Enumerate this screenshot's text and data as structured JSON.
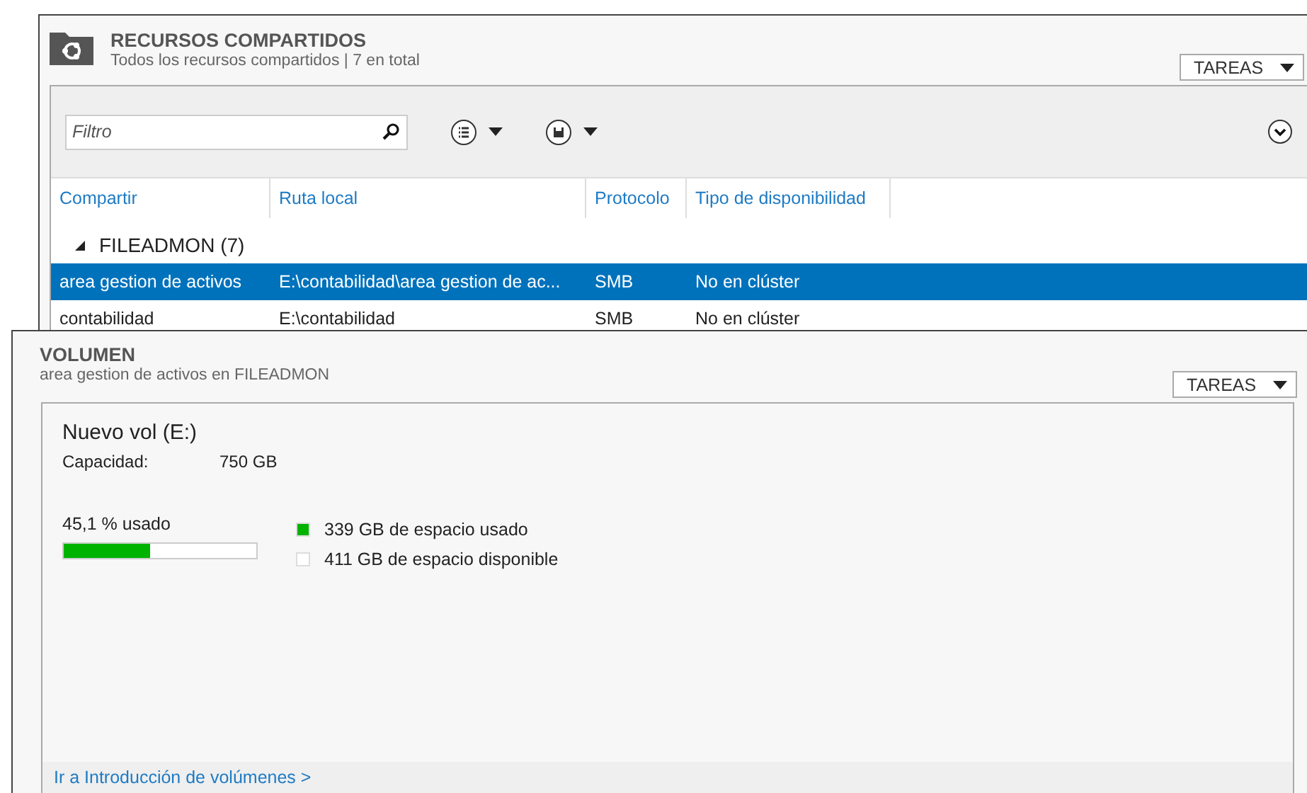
{
  "shares_panel": {
    "title": "RECURSOS COMPARTIDOS",
    "subtitle": "Todos los recursos compartidos | 7 en total",
    "tasks_button": "TAREAS",
    "filter": {
      "placeholder": "Filtro"
    },
    "table": {
      "columns": [
        "Compartir",
        "Ruta local",
        "Protocolo",
        "Tipo de disponibilidad"
      ],
      "group": {
        "label": "FILEADMON (7)",
        "expanded": true
      },
      "rows": [
        {
          "cells": [
            "area gestion de activos",
            "E:\\contabilidad\\area gestion de ac...",
            "SMB",
            "No en clúster"
          ],
          "selected": true
        },
        {
          "cells": [
            "contabilidad",
            "E:\\contabilidad",
            "SMB",
            "No en clúster"
          ],
          "selected": false
        }
      ]
    }
  },
  "volume_panel": {
    "title": "VOLUMEN",
    "subtitle": "area gestion de activos en FILEADMON",
    "tasks_button": "TAREAS",
    "volume_name": "Nuevo vol (E:)",
    "capacity_label": "Capacidad:",
    "capacity_value": "750 GB",
    "usage": {
      "label": "45,1 % usado",
      "level": 0.451
    },
    "legend": [
      {
        "label": "339 GB de espacio usado",
        "color": "#00b300"
      },
      {
        "label": "411 GB de espacio disponible",
        "color": "#ffffff"
      }
    ],
    "link": "Ir a Introducción de volúmenes >"
  }
}
